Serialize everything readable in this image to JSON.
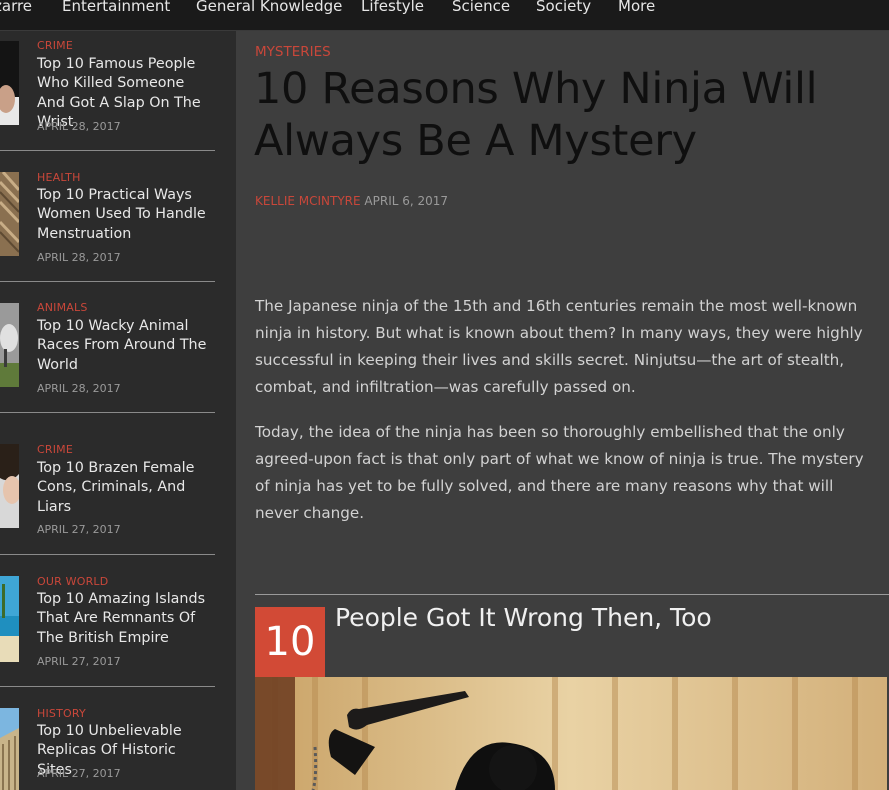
{
  "nav": {
    "items": [
      "zarre",
      "Entertainment",
      "General Knowledge",
      "Lifestyle",
      "Science",
      "Society",
      "More"
    ]
  },
  "sidebar": {
    "items": [
      {
        "category": "CRIME",
        "title": "Top 10 Famous People Who Killed Someone And Got A Slap On The Wrist",
        "date": "APRIL 28, 2017"
      },
      {
        "category": "HEALTH",
        "title": "Top 10 Practical Ways Women Used To Handle Menstruation",
        "date": "APRIL 28, 2017"
      },
      {
        "category": "ANIMALS",
        "title": "Top 10 Wacky Animal Races From Around The World",
        "date": "APRIL 28, 2017"
      },
      {
        "category": "CRIME",
        "title": "Top 10 Brazen Female Cons, Criminals, And Liars",
        "date": "APRIL 27, 2017"
      },
      {
        "category": "OUR WORLD",
        "title": "Top 10 Amazing Islands That Are Remnants Of The British Empire",
        "date": "APRIL 27, 2017"
      },
      {
        "category": "HISTORY",
        "title": "Top 10 Unbelievable Replicas Of Historic Sites",
        "date": "APRIL 27, 2017"
      }
    ]
  },
  "article": {
    "category": "MYSTERIES",
    "title": "10 Reasons Why Ninja Will Always Be A Mystery",
    "author": "KELLIE MCINTYRE",
    "date": "APRIL 6, 2017",
    "paragraphs": [
      "The Japanese ninja of the 15th and 16th centuries remain the most well-known ninja in history. But what is known about them? In many ways, they were highly successful in keeping their lives and skills secret. Ninjutsu—the art of stealth, combat, and infiltration—was carefully passed on.",
      "Today, the idea of the ninja has been so thoroughly embellished that the only agreed-upon fact is that only part of what we know of ninja is true. The mystery of ninja has yet to be fully solved, and there are many reasons why that will never change."
    ],
    "section": {
      "number": "10",
      "title": "People Got It Wrong Then, Too"
    }
  },
  "colors": {
    "accent": "#c9473a",
    "number_box": "#d24a36",
    "nav_bg": "#1a1a1a",
    "main_bg": "#3e3e3e",
    "sidebar_bg": "#2b2b2b"
  }
}
